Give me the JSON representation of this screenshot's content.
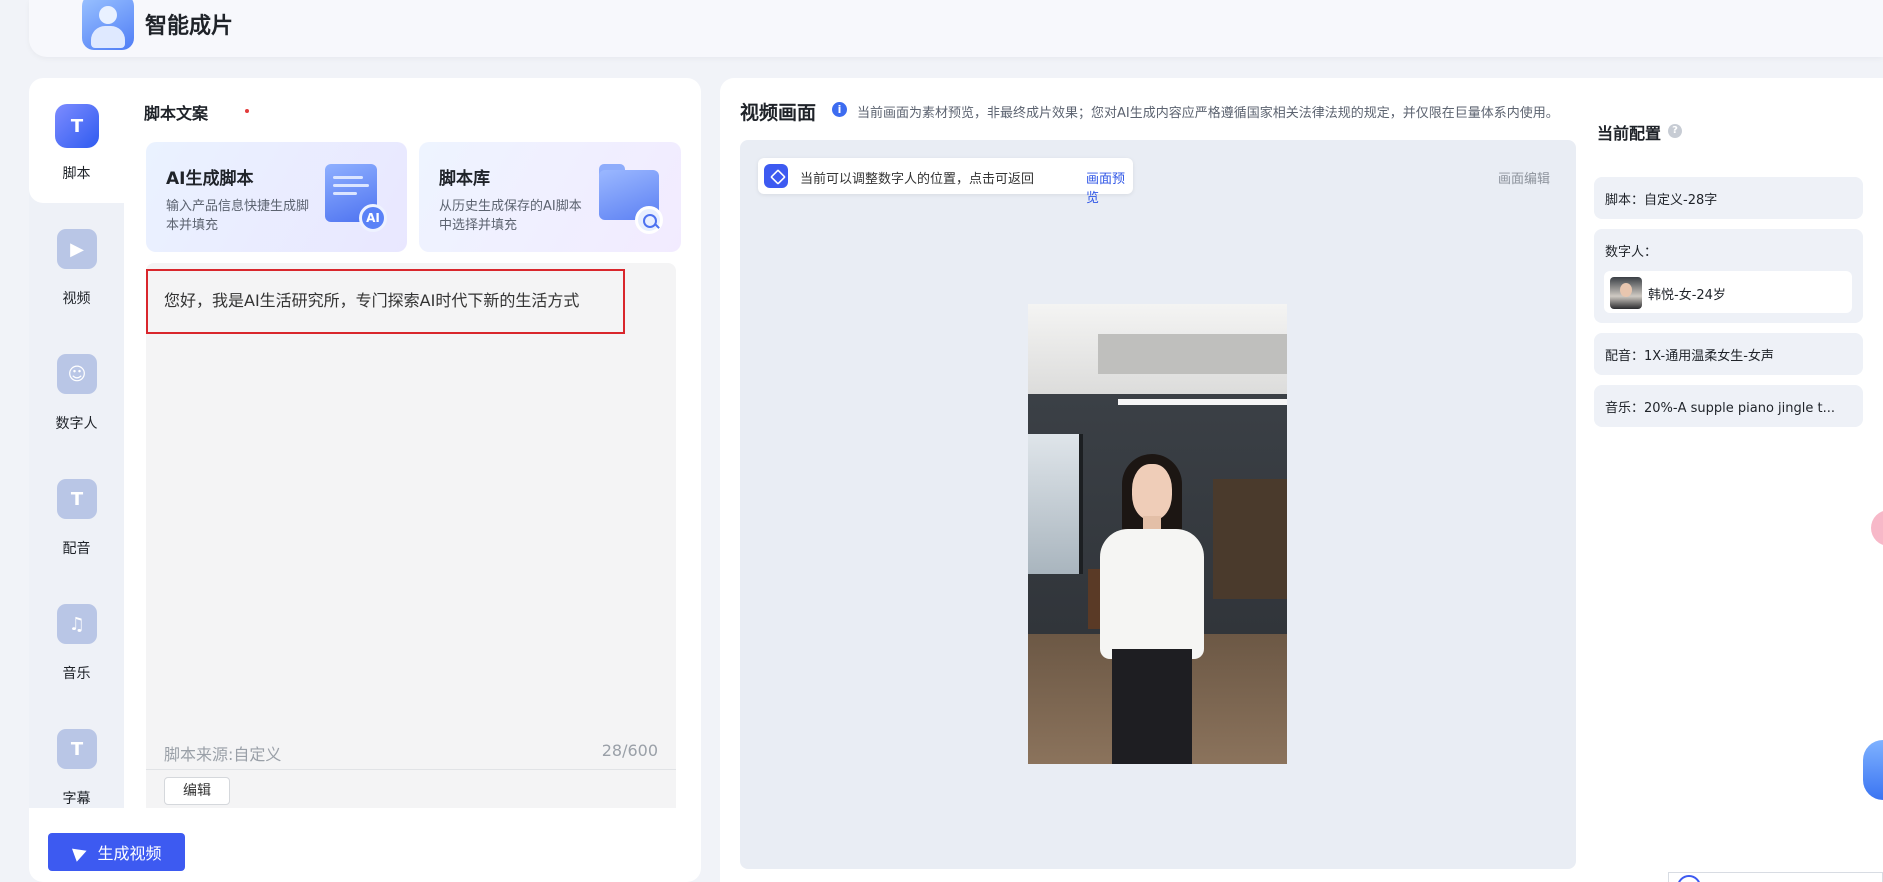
{
  "header": {
    "app_title": "智能成片",
    "logo_icon": "app-logo-icon"
  },
  "nav": {
    "items": [
      {
        "label": "脚本",
        "icon": "script-icon",
        "glyph": "T",
        "active": true
      },
      {
        "label": "视频",
        "icon": "video-icon",
        "glyph": "▶",
        "active": false
      },
      {
        "label": "数字人",
        "icon": "digital-human-icon",
        "glyph": "☺",
        "active": false
      },
      {
        "label": "配音",
        "icon": "voiceover-icon",
        "glyph": "T",
        "active": false
      },
      {
        "label": "音乐",
        "icon": "music-icon",
        "glyph": "♫",
        "active": false
      },
      {
        "label": "字幕",
        "icon": "subtitle-icon",
        "glyph": "T",
        "active": false
      }
    ]
  },
  "script_panel": {
    "title": "脚本文案",
    "cards": [
      {
        "title": "AI生成脚本",
        "desc": "输入产品信息快捷生成脚本并填充",
        "badge": "AI"
      },
      {
        "title": "脚本库",
        "desc": "从历史生成保存的AI脚本中选择并填充"
      }
    ],
    "script_text": "您好，我是AI生活研究所，专门探索AI时代下新的生活方式",
    "source_label": "脚本来源:自定义",
    "char_count": "28/600",
    "edit_button": "编辑"
  },
  "generate_button": "生成视频",
  "video_panel": {
    "title": "视频画面",
    "info_glyph": "i",
    "notice": "当前画面为素材预览，非最终成片效果；您对AI生成内容应严格遵循国家相关法律法规的规定，并仅限在巨量体系内使用。",
    "hint_text": "当前可以调整数字人的位置，点击可返回",
    "hint_link": "画面预览",
    "canvas_edit": "画面编辑"
  },
  "config": {
    "title": "当前配置",
    "help_glyph": "?",
    "script": "脚本：自定义-28字",
    "digital_human_label": "数字人：",
    "digital_human_name": "韩悦-女-24岁",
    "voiceover": "配音：1X-通用温柔女生-女声",
    "music": "音乐：20%-A supple piano jingle t..."
  }
}
